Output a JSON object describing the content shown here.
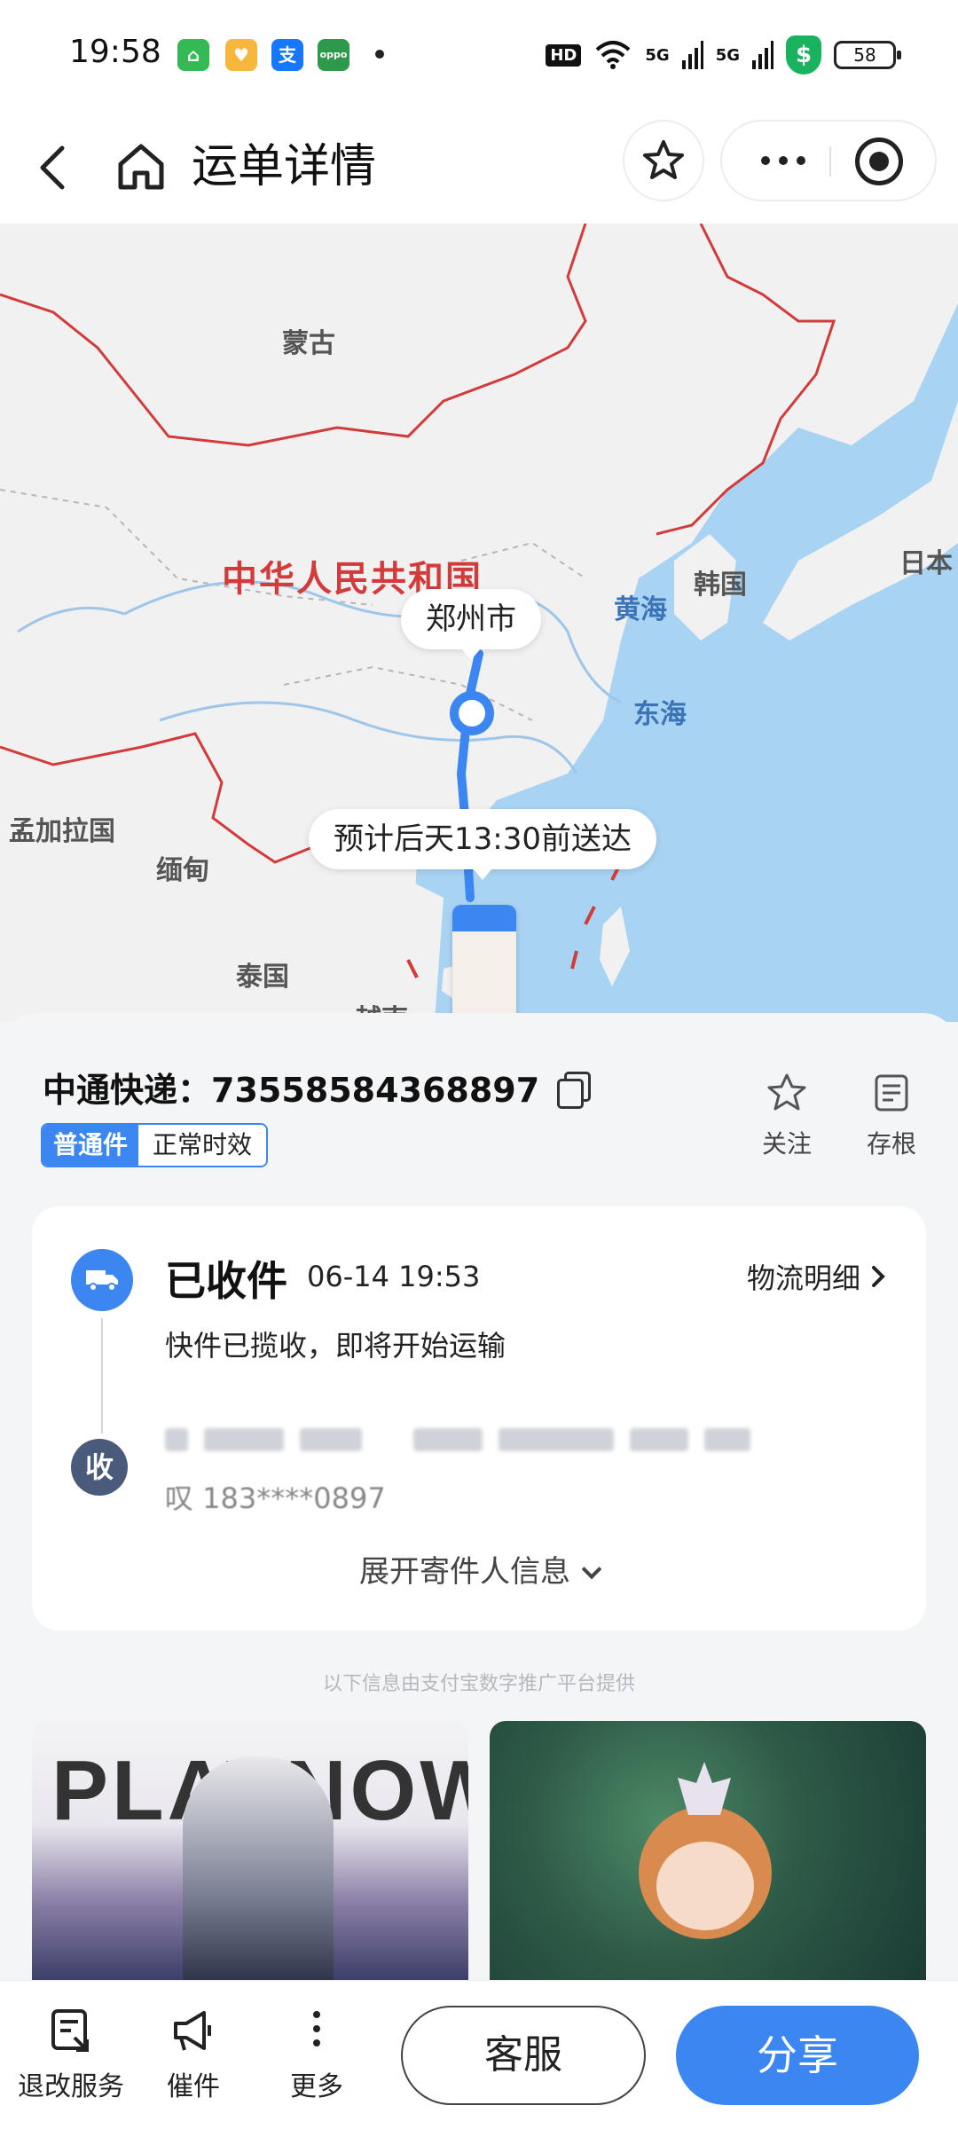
{
  "status_bar": {
    "time": "19:58",
    "apps": [
      {
        "icon": "app-store-icon",
        "glyph": "⌂",
        "color": "#34b955"
      },
      {
        "icon": "coupon-app-icon",
        "glyph": "♥",
        "color": "#f6b73c"
      },
      {
        "icon": "alipay-icon",
        "glyph": "支",
        "color": "#1677ff"
      },
      {
        "icon": "oppo-app-icon",
        "glyph": "oppo",
        "color": "#2c9a4a"
      }
    ],
    "hd": "HD",
    "signal_1": "5G",
    "signal_2": "5G",
    "shield": "$",
    "battery": "58"
  },
  "nav": {
    "title": "运单详情"
  },
  "map": {
    "labels": [
      {
        "text": "蒙古",
        "style": ""
      },
      {
        "text": "中华人民共和国",
        "style": "red"
      },
      {
        "text": "韩国",
        "style": ""
      },
      {
        "text": "日本",
        "style": ""
      },
      {
        "text": "黄海",
        "style": "blue"
      },
      {
        "text": "东海",
        "style": "blue"
      },
      {
        "text": "孟加拉国",
        "style": ""
      },
      {
        "text": "缅甸",
        "style": ""
      },
      {
        "text": "泰国",
        "style": ""
      },
      {
        "text": "越南",
        "style": ""
      }
    ],
    "city_callout": "郑州市",
    "eta_callout": "预计后天13:30前送达"
  },
  "shipment": {
    "tracking": "中通快递：73558584368897",
    "tag_primary": "普通件",
    "tag_secondary": "正常时效",
    "follow_label": "关注",
    "stub_label": "存根"
  },
  "status_card": {
    "title": "已收件",
    "time": "06-14 19:53",
    "detail_link": "物流明细",
    "description": "快件已揽收，即将开始运输",
    "receiver_badge": "收",
    "receiver_phone": "叹 183****0897",
    "expand_label": "展开寄件人信息"
  },
  "promo": {
    "note": "以下信息由支付宝数字推广平台提供",
    "ad_left_text": "PLAYNOW"
  },
  "bottom_bar": {
    "refund_label": "退改服务",
    "urge_label": "催件",
    "more_label": "更多",
    "service_label": "客服",
    "share_label": "分享"
  },
  "colors": {
    "accent": "#3b86f0",
    "border_red": "#d33b3b",
    "sea": "#a9d3f3"
  }
}
